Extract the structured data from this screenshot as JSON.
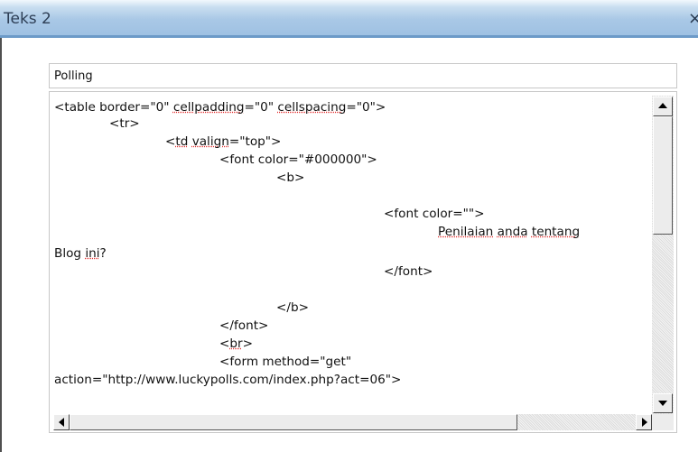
{
  "window": {
    "title": "Teks 2",
    "close_glyph": "×"
  },
  "form": {
    "title_value": "Polling"
  },
  "editor": {
    "lines": [
      [
        {
          "t": "<table border=\"0\" "
        },
        {
          "t": "cellpadding",
          "sq": true
        },
        {
          "t": "=\"0\" "
        },
        {
          "t": "cellspacing",
          "sq": true
        },
        {
          "t": "=\"0\">"
        }
      ],
      [
        {
          "t": "<tr>"
        }
      ],
      [
        {
          "t": "<"
        },
        {
          "t": "td",
          "sq": true
        },
        {
          "t": " "
        },
        {
          "t": "valign",
          "sq": true
        },
        {
          "t": "=\"top\">"
        }
      ],
      [
        {
          "t": "<font color=\"#000000\">"
        }
      ],
      [
        {
          "t": "<b>"
        }
      ],
      [],
      [
        {
          "t": "<font color=\"\">"
        }
      ],
      [
        {
          "t": "Penilaian",
          "sq": true
        },
        {
          "t": " "
        },
        {
          "t": "anda",
          "sq": true
        },
        {
          "t": " "
        },
        {
          "t": "tentang",
          "sq": true
        }
      ],
      [
        {
          "t": "Blog "
        },
        {
          "t": "ini",
          "sq": true
        },
        {
          "t": "?"
        }
      ],
      [
        {
          "t": "</font>"
        }
      ],
      [],
      [
        {
          "t": "</b>"
        }
      ],
      [
        {
          "t": "</font>"
        }
      ],
      [
        {
          "t": "<"
        },
        {
          "t": "br",
          "sq": true
        },
        {
          "t": ">"
        }
      ],
      [
        {
          "t": "<form method=\"get\""
        }
      ],
      [
        {
          "t": "action=\"http://www.luckypolls.com/index.php?act=06\">"
        }
      ]
    ]
  },
  "colors": {
    "spell_underline": "#e23030",
    "title_bar": "#a9c8e6"
  },
  "icons": {
    "close": "close-icon",
    "up": "arrow-up-icon",
    "down": "arrow-down-icon",
    "left": "arrow-left-icon",
    "right": "arrow-right-icon"
  }
}
